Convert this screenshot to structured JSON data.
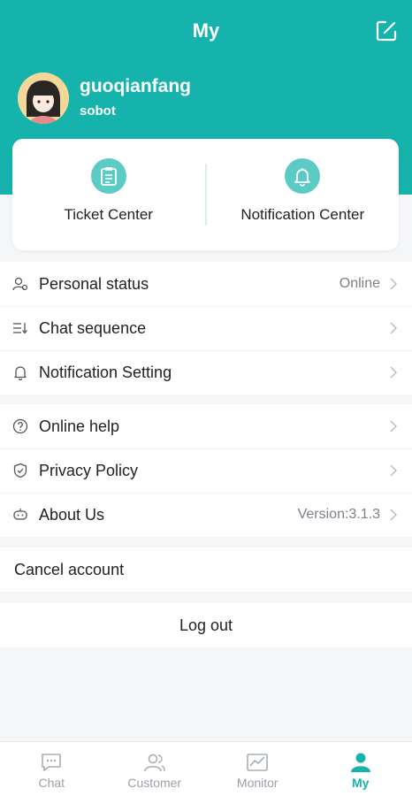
{
  "header": {
    "title": "My",
    "user_name": "guoqianfang",
    "org": "sobot",
    "accent_color": "#16b3ad"
  },
  "card": {
    "items": [
      {
        "label": "Ticket Center",
        "icon": "clipboard-icon"
      },
      {
        "label": "Notification Center",
        "icon": "bell-icon"
      }
    ]
  },
  "settings": {
    "personal_status": {
      "label": "Personal status",
      "value": "Online",
      "icon": "person-status-icon"
    },
    "chat_sequence": {
      "label": "Chat sequence",
      "icon": "sort-list-icon"
    },
    "notification_setting": {
      "label": "Notification Setting",
      "icon": "bell-outline-icon"
    }
  },
  "info": {
    "online_help": {
      "label": "Online help",
      "icon": "help-circle-icon"
    },
    "privacy_policy": {
      "label": "Privacy Policy",
      "icon": "shield-icon"
    },
    "about_us": {
      "label": "About Us",
      "value": "Version:3.1.3",
      "icon": "robot-icon"
    }
  },
  "account": {
    "cancel_label": "Cancel account",
    "logout_label": "Log out"
  },
  "tabbar": {
    "tabs": [
      {
        "label": "Chat",
        "icon": "chat-icon",
        "active": false
      },
      {
        "label": "Customer",
        "icon": "customer-icon",
        "active": false
      },
      {
        "label": "Monitor",
        "icon": "monitor-icon",
        "active": false
      },
      {
        "label": "My",
        "icon": "person-icon",
        "active": true
      }
    ]
  }
}
